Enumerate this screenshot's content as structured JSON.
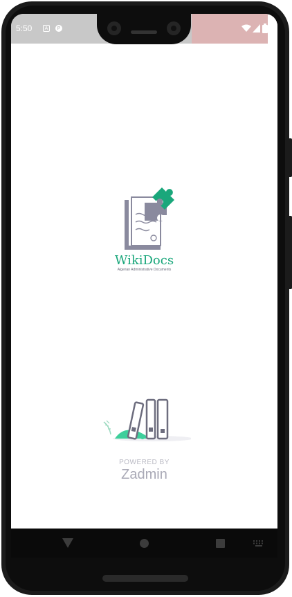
{
  "status_bar": {
    "time": "5:50",
    "left_icons": [
      "A",
      "P"
    ],
    "right_icons": [
      "wifi-icon",
      "signal-icon",
      "battery-icon"
    ]
  },
  "app": {
    "name": "WikiDocs",
    "tagline": "Algerian Administrative Documents",
    "powered_by": "POWERED BY",
    "company": "Zadmin"
  },
  "colors": {
    "brand_green": "#1aa77b",
    "logo_gray": "#8a8a9e",
    "muted_text": "#a9a9b6"
  },
  "nav_bar": {
    "buttons": [
      "back-icon",
      "home-icon",
      "recents-icon",
      "keyboard-icon"
    ]
  }
}
